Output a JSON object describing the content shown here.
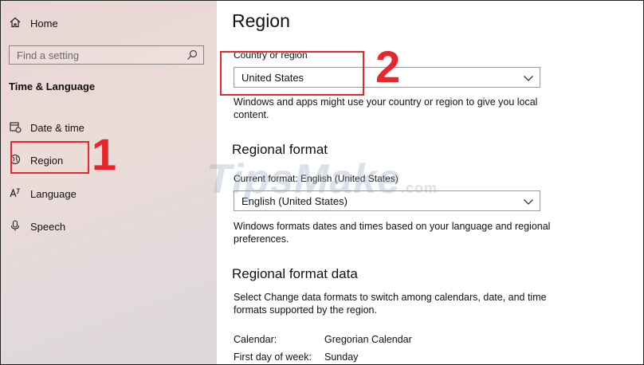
{
  "sidebar": {
    "home_label": "Home",
    "search_placeholder": "Find a setting",
    "section_title": "Time & Language",
    "items": [
      {
        "label": "Date & time",
        "icon": "calendar-clock-icon"
      },
      {
        "label": "Region",
        "icon": "globe-icon"
      },
      {
        "label": "Language",
        "icon": "language-icon"
      },
      {
        "label": "Speech",
        "icon": "microphone-icon"
      }
    ]
  },
  "main": {
    "title": "Region",
    "country": {
      "label": "Country or region",
      "value": "United States",
      "description": "Windows and apps might use your country or region to give you local content."
    },
    "regional_format": {
      "heading": "Regional format",
      "current_label": "Current format: English (United States)",
      "value": "English (United States)",
      "description": "Windows formats dates and times based on your language and regional preferences."
    },
    "format_data": {
      "heading": "Regional format data",
      "description": "Select Change data formats to switch among calendars, date, and time formats supported by the region.",
      "rows": [
        {
          "key": "Calendar:",
          "value": "Gregorian Calendar"
        },
        {
          "key": "First day of week:",
          "value": "Sunday"
        }
      ]
    }
  },
  "annotations": {
    "step1": "1",
    "step2": "2",
    "color": "#e8262b"
  },
  "watermark": {
    "text": "TipsMake",
    "suffix": ".com"
  }
}
